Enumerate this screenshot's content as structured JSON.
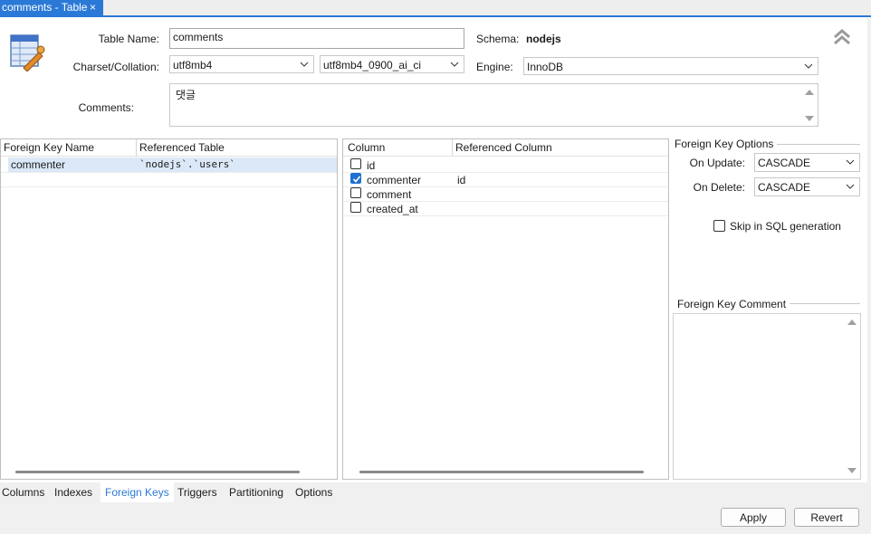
{
  "tab": {
    "title": "comments - Table",
    "close_glyph": "×"
  },
  "form": {
    "table_name_label": "Table Name:",
    "table_name_value": "comments",
    "schema_label": "Schema:",
    "schema_value": "nodejs",
    "charset_label": "Charset/Collation:",
    "charset_value": "utf8mb4",
    "collation_value": "utf8mb4_0900_ai_ci",
    "engine_label": "Engine:",
    "engine_value": "InnoDB",
    "comments_label": "Comments:",
    "comments_value": "댓글"
  },
  "fk_list": {
    "headers": [
      "Foreign Key Name",
      "Referenced Table"
    ],
    "rows": [
      {
        "name": "commenter",
        "table": "`nodejs`.`users`"
      }
    ]
  },
  "columns": {
    "headers": [
      "Column",
      "Referenced Column"
    ],
    "rows": [
      {
        "name": "id",
        "checked": false,
        "ref": ""
      },
      {
        "name": "commenter",
        "checked": true,
        "ref": "id"
      },
      {
        "name": "comment",
        "checked": false,
        "ref": ""
      },
      {
        "name": "created_at",
        "checked": false,
        "ref": ""
      }
    ]
  },
  "options": {
    "title": "Foreign Key Options",
    "on_update_label": "On Update:",
    "on_update_value": "CASCADE",
    "on_delete_label": "On Delete:",
    "on_delete_value": "CASCADE",
    "skip_label": "Skip in SQL generation",
    "comment_title": "Foreign Key Comment"
  },
  "bottom_tabs": [
    "Columns",
    "Indexes",
    "Foreign Keys",
    "Triggers",
    "Partitioning",
    "Options"
  ],
  "active_tab": "Foreign Keys",
  "buttons": {
    "apply": "Apply",
    "revert": "Revert"
  },
  "colors": {
    "accent": "#2b79d6",
    "selection": "#dbe8f7",
    "checkbox": "#1f6fd1"
  },
  "icons": [
    "table-edit-icon",
    "collapse-up-icon",
    "close-icon",
    "chevron-down-icon",
    "scroll-up-icon",
    "scroll-down-icon",
    "checkmark-icon"
  ]
}
